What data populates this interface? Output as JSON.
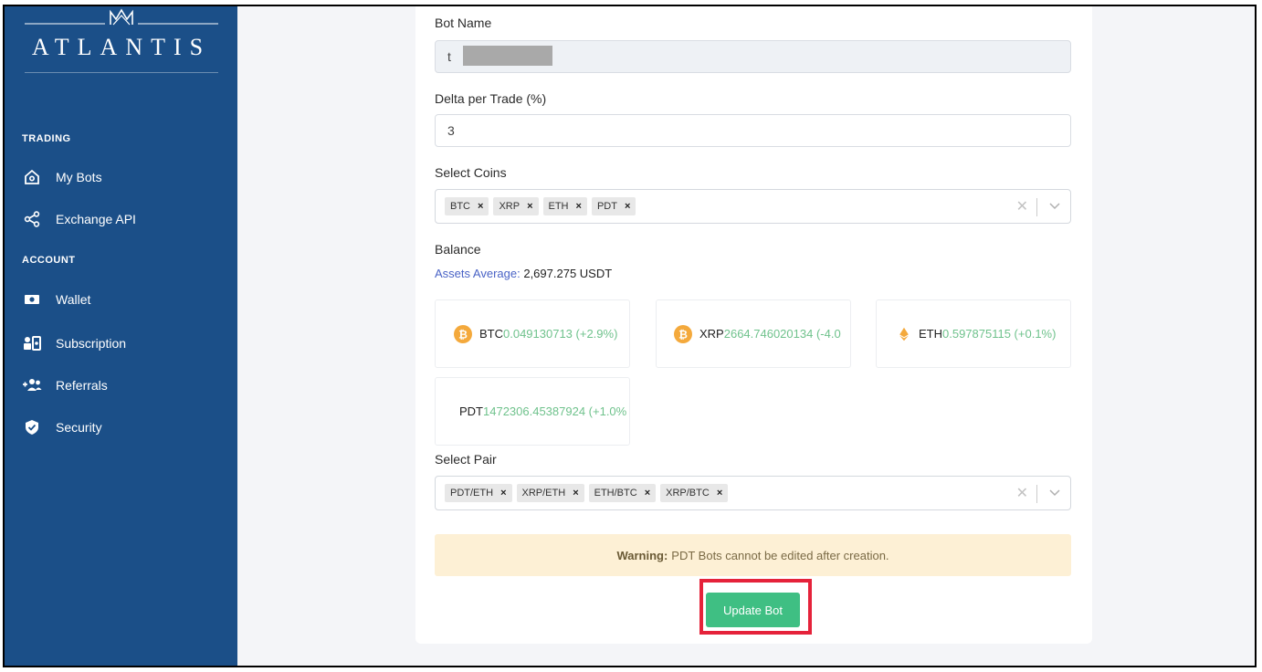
{
  "brand": {
    "name": "ATLANTIS"
  },
  "sidebar": {
    "sections": [
      {
        "label": "TRADING"
      },
      {
        "label": "ACCOUNT"
      }
    ],
    "items": [
      {
        "label": "My Bots",
        "icon": "home-icon"
      },
      {
        "label": "Exchange API",
        "icon": "share-icon"
      },
      {
        "label": "Wallet",
        "icon": "wallet-icon"
      },
      {
        "label": "Subscription",
        "icon": "subscription-icon"
      },
      {
        "label": "Referrals",
        "icon": "add-users-icon"
      },
      {
        "label": "Security",
        "icon": "shield-icon"
      }
    ]
  },
  "form": {
    "bot_name": {
      "label": "Bot Name",
      "value": "t"
    },
    "delta": {
      "label": "Delta per Trade (%)",
      "value": "3"
    },
    "coins": {
      "label": "Select Coins",
      "selected": [
        "BTC",
        "XRP",
        "ETH",
        "PDT"
      ],
      "remove_glyph": "×"
    },
    "balance": {
      "label": "Balance",
      "assets_average_label": "Assets Average:",
      "assets_average_value": "2,697.275 USDT",
      "coins": [
        {
          "symbol": "BTC",
          "value": "0.049130713 (+2.9%)",
          "icon": "bitcoin-icon",
          "icon_color": "#f4a93c"
        },
        {
          "symbol": "XRP",
          "value": "2664.746020134 (-4.0",
          "icon": "bitcoin-icon",
          "icon_color": "#f4a93c"
        },
        {
          "symbol": "ETH",
          "value": "0.597875115 (+0.1%)",
          "icon": "ethereum-icon",
          "icon_color": "#f4a93c"
        },
        {
          "symbol": "PDT",
          "value": "1472306.45387924 (+1.0%",
          "icon": "",
          "icon_color": ""
        }
      ]
    },
    "pairs": {
      "label": "Select Pair",
      "selected": [
        "PDT/ETH",
        "XRP/ETH",
        "ETH/BTC",
        "XRP/BTC"
      ],
      "remove_glyph": "×"
    },
    "warning": {
      "title": "Warning:",
      "text": "PDT Bots cannot be edited after creation."
    },
    "submit_label": "Update Bot"
  },
  "colors": {
    "sidebar": "#1b4f88",
    "accent_green": "#3fbf83",
    "highlight_red": "#e5223a",
    "gain_green": "#6fc28c"
  }
}
